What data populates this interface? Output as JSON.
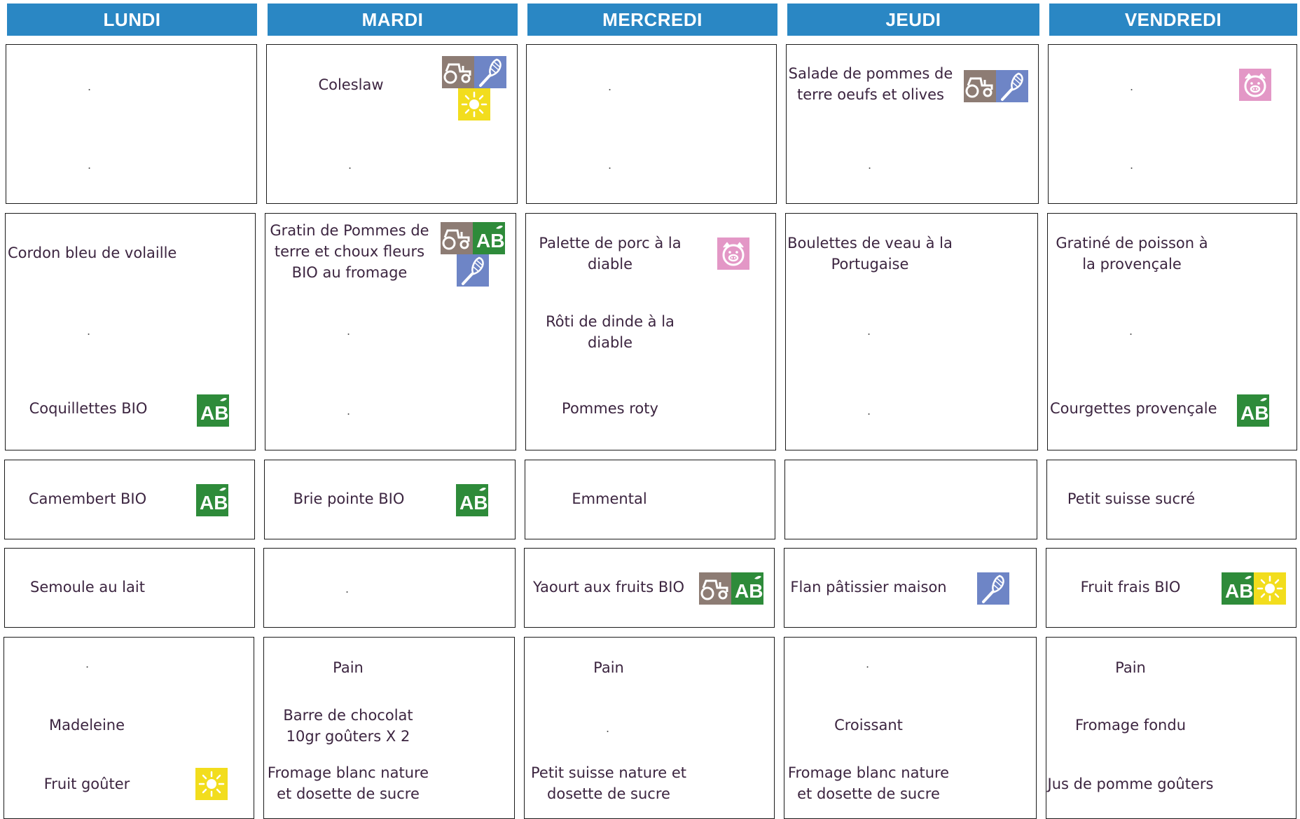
{
  "days": [
    "LUNDI",
    "MARDI",
    "MERCREDI",
    "JEUDI",
    "VENDREDI"
  ],
  "colors": {
    "header": "#2a87c4",
    "bio_label": "#2e8b3a",
    "local_farm_label": "#8d7c74",
    "homemade_label": "#6e85c6",
    "seasonal_label": "#f2dd1d",
    "pork_label": "#e397c6",
    "text": "#3c2540"
  },
  "icon_labels": {
    "bio": "AB"
  },
  "dot": ".",
  "menu": {
    "starter": {
      "mardi": "Coleslaw",
      "jeudi": "Salade de pommes de terre oeufs et olives"
    },
    "main": {
      "lundi": "Cordon bleu de volaille",
      "mardi": "Gratin de Pommes de terre et choux fleurs BIO au fromage",
      "mercredi_1": "Palette de porc à la diable",
      "mercredi_2": "Rôti de dinde à la diable",
      "jeudi": "Boulettes de veau à la Portugaise",
      "vendredi": "Gratiné de poisson à la provençale"
    },
    "side": {
      "lundi": "Coquillettes BIO",
      "mercredi": "Pommes roty",
      "vendredi": "Courgettes provençale"
    },
    "dairy": {
      "lundi": "Camembert BIO",
      "mardi": "Brie pointe BIO",
      "mercredi": "Emmental",
      "vendredi": "Petit suisse sucré"
    },
    "dessert": {
      "lundi": "Semoule au lait",
      "mercredi": "Yaourt aux fruits BIO",
      "jeudi": "Flan pâtissier maison",
      "vendredi": "Fruit frais BIO"
    },
    "snack": {
      "lundi": [
        "Madeleine",
        "Fruit goûter"
      ],
      "mardi": [
        "Pain",
        "Barre de chocolat 10gr goûters X 2",
        "Fromage blanc nature et dosette de sucre"
      ],
      "mercredi": [
        "Pain",
        "Petit suisse nature et dosette de sucre"
      ],
      "jeudi": [
        "Croissant",
        "Fromage blanc nature et dosette de sucre"
      ],
      "vendredi": [
        "Pain",
        "Fromage fondu",
        "Jus de pomme goûters"
      ]
    }
  }
}
